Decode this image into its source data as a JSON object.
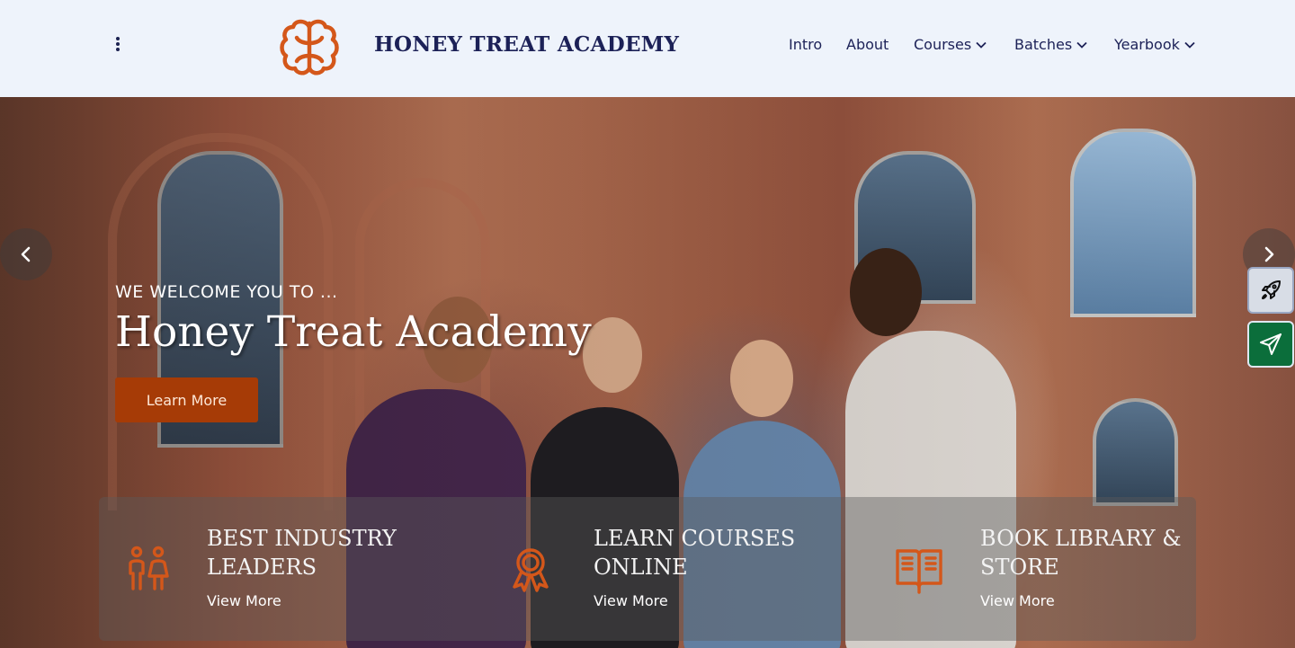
{
  "header": {
    "brand": "HONEY TREAT ACADEMY",
    "menu_icon": "kebab-menu-icon",
    "logo_icon": "brain-logo-icon",
    "nav": [
      {
        "label": "Intro",
        "dropdown": false
      },
      {
        "label": "About",
        "dropdown": false
      },
      {
        "label": "Courses",
        "dropdown": true
      },
      {
        "label": "Batches",
        "dropdown": true
      },
      {
        "label": "Yearbook",
        "dropdown": true
      }
    ]
  },
  "hero": {
    "welcome": "WE WELCOME YOU TO ...",
    "title": "Honey Treat Academy",
    "cta": "Learn More",
    "prev_icon": "chevron-left-icon",
    "next_icon": "chevron-right-icon"
  },
  "floating": {
    "rocket_icon": "rocket-icon",
    "send_icon": "paper-plane-icon"
  },
  "features": [
    {
      "title_line1": "BEST INDUSTRY",
      "title_line2": "LEADERS",
      "link": "View More",
      "icon": "people-icon"
    },
    {
      "title_line1": "LEARN COURSES",
      "title_line2": "ONLINE",
      "link": "View More",
      "icon": "award-ribbon-icon"
    },
    {
      "title_line1": "BOOK LIBRARY &",
      "title_line2": "STORE",
      "link": "View More",
      "icon": "open-book-icon"
    }
  ],
  "colors": {
    "brand_navy": "#1c2157",
    "accent_orange": "#d4571a",
    "cta_bg": "#a63b06",
    "send_green": "#0b6e3b",
    "header_bg": "#eef3fb"
  }
}
